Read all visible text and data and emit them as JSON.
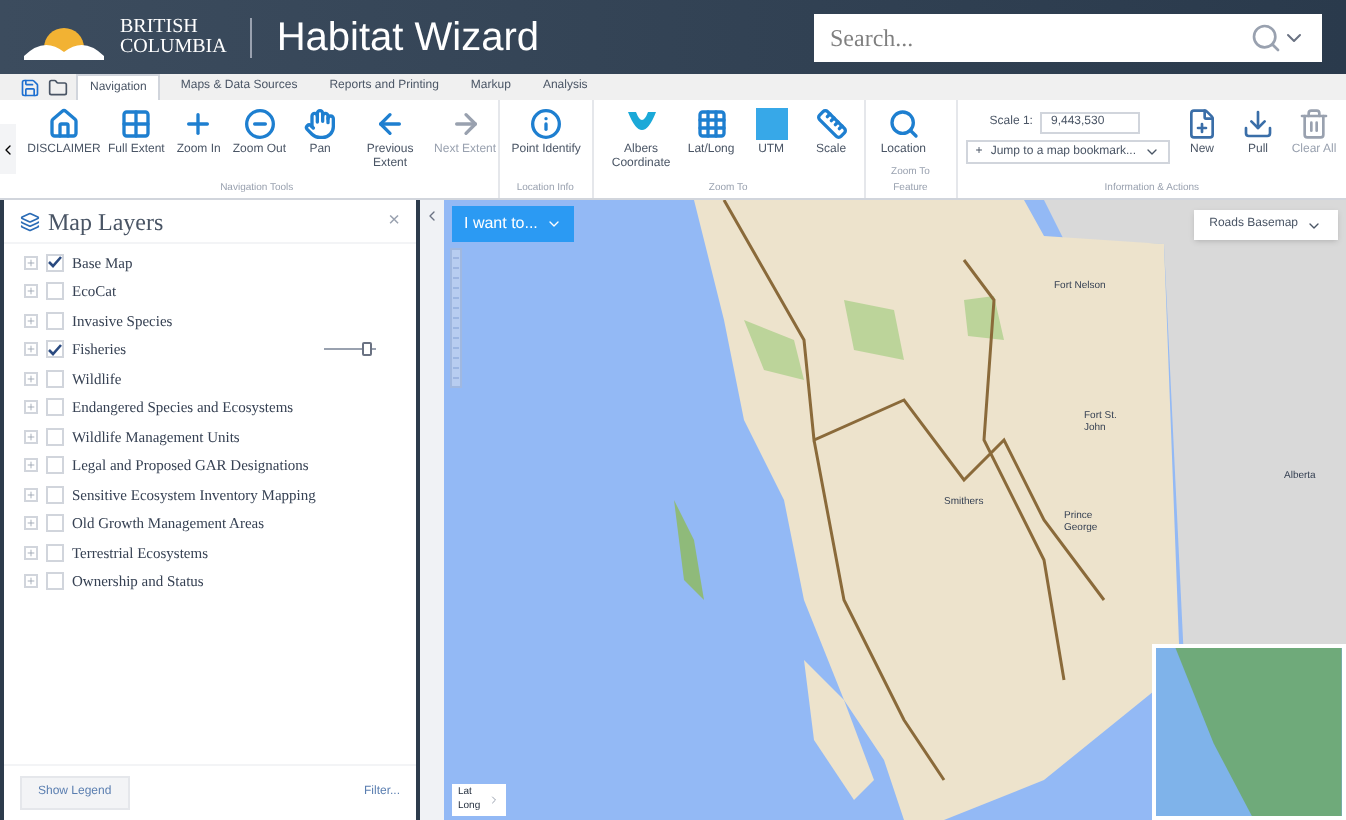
{
  "header": {
    "logo_line1": "BRITISH",
    "logo_line2": "COLUMBIA",
    "title": "Habitat Wizard",
    "search": {
      "placeholder": "Search..."
    }
  },
  "tabs": [
    {
      "label": "Navigation",
      "selected": true
    },
    {
      "label": "Maps & Data Sources",
      "selected": false
    },
    {
      "label": "Reports and Printing",
      "selected": false
    },
    {
      "label": "Markup",
      "selected": false
    },
    {
      "label": "Analysis",
      "selected": false
    }
  ],
  "ribbon": {
    "groups": [
      {
        "label": "Navigation Tools",
        "buttons": [
          {
            "label": "DISCLAIMER",
            "disabled": false
          },
          {
            "label": "Full Extent",
            "disabled": false
          },
          {
            "label": "Zoom In",
            "disabled": false
          },
          {
            "label": "Zoom Out",
            "disabled": false
          },
          {
            "label": "Pan",
            "disabled": false
          },
          {
            "label": "Previous Extent",
            "disabled": false
          },
          {
            "label": "Next Extent",
            "disabled": true
          }
        ]
      },
      {
        "label": "Location Info",
        "buttons": [
          {
            "label": "Point Identify",
            "disabled": false
          }
        ]
      },
      {
        "label": "Zoom To",
        "buttons": [
          {
            "label": "Albers Coordinate",
            "disabled": false
          },
          {
            "label": "Lat/Long",
            "disabled": false
          },
          {
            "label": "UTM",
            "disabled": false
          },
          {
            "label": "Scale",
            "disabled": false
          }
        ]
      },
      {
        "label": "Zoom To Feature",
        "buttons": [
          {
            "label": "Location",
            "disabled": false
          }
        ]
      }
    ],
    "info_group": {
      "label": "Information & Actions",
      "scale_label": "Scale 1:",
      "scale_value": "9,443,530",
      "bookmark_plus": "+",
      "bookmark": "Jump to a map bookmark...",
      "buttons": [
        {
          "label": "New",
          "disabled": false
        },
        {
          "label": "Pull",
          "disabled": false
        },
        {
          "label": "Clear All",
          "disabled": true
        }
      ]
    }
  },
  "layers_panel": {
    "title": "Map Layers",
    "close": "×",
    "layers": [
      {
        "name": "Base Map",
        "checked": true
      },
      {
        "name": "EcoCat",
        "checked": false
      },
      {
        "name": "Invasive Species",
        "checked": false
      },
      {
        "name": "Fisheries",
        "checked": true,
        "level": 0.85
      },
      {
        "name": "Wildlife",
        "checked": false
      },
      {
        "name": "Endangered Species and Ecosystems",
        "checked": false
      },
      {
        "name": "Wildlife Management Units",
        "checked": false
      },
      {
        "name": "Legal and Proposed GAR Designations",
        "checked": false
      },
      {
        "name": "Sensitive Ecosystem Inventory Mapping",
        "checked": false
      },
      {
        "name": "Old Growth Management Areas",
        "checked": false
      },
      {
        "name": "Terrestrial Ecosystems",
        "checked": false
      },
      {
        "name": "Ownership and Status",
        "checked": false
      }
    ],
    "show_legend": "Show Legend",
    "filter": "Filter..."
  },
  "map": {
    "i_want_to": "I want to...",
    "basemap": "Roads Basemap",
    "lat_long": [
      "Lat",
      "Long"
    ],
    "places": [
      "Fort Nelson",
      "Fort St. John",
      "Smithers",
      "Prince George",
      "Alberta"
    ]
  }
}
